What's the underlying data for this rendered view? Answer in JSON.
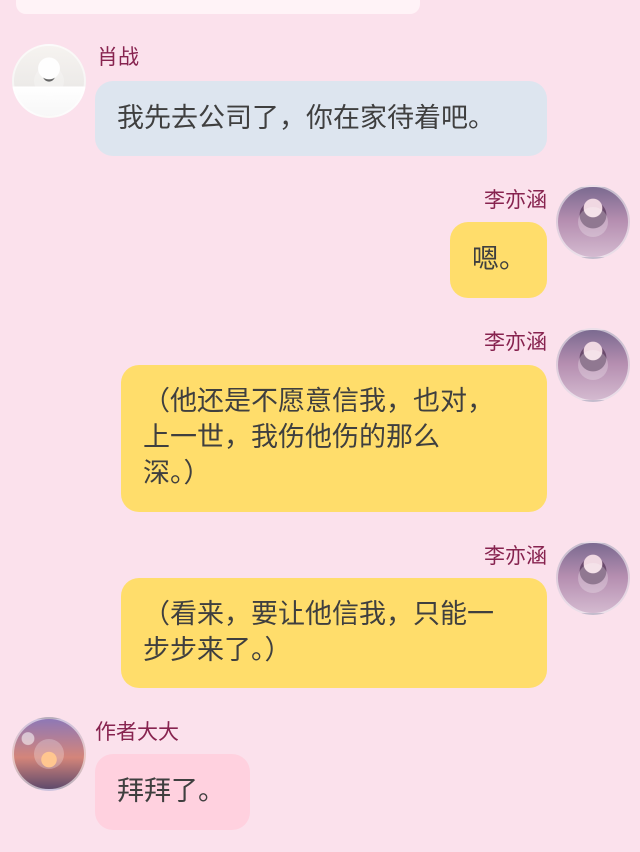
{
  "chat": {
    "messages": [
      {
        "side": "left",
        "name": "肖战",
        "lines": [
          "我先去公司了，你在家待着吧。"
        ],
        "bubble_color": "#dde5ef",
        "avatar": "avatar-image"
      },
      {
        "side": "right",
        "name": "李亦涵",
        "lines": [
          "嗯。"
        ],
        "bubble_color": "#ffdd6b",
        "avatar": "avatar-image"
      },
      {
        "side": "right",
        "name": "李亦涵",
        "lines": [
          "（他还是不愿意信我，也对，",
          "上一世，我伤他伤的那么",
          "深。）"
        ],
        "bubble_color": "#ffdd6b",
        "avatar": "avatar-image"
      },
      {
        "side": "right",
        "name": "李亦涵",
        "lines": [
          "（看来，要让他信我，只能一",
          "步步来了。）"
        ],
        "bubble_color": "#ffdd6b",
        "avatar": "avatar-image"
      },
      {
        "side": "left",
        "name": "作者大大",
        "lines": [
          "拜拜了。"
        ],
        "bubble_color": "#ffd1df",
        "avatar": "avatar-image"
      }
    ]
  },
  "colors": {
    "background": "#fbe1ec",
    "name": "#87234f",
    "text": "#3f3f3f"
  }
}
